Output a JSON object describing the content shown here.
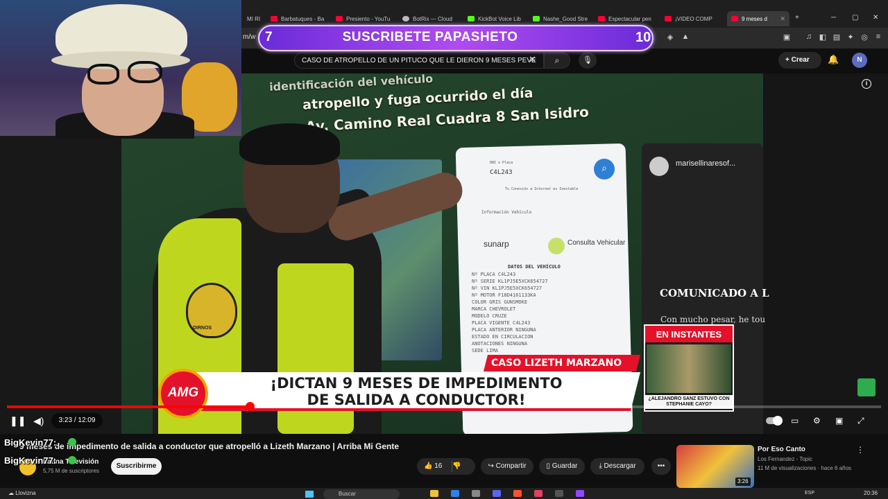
{
  "browser": {
    "tabs": [
      {
        "label": "MI RI",
        "active": false
      },
      {
        "label": "Barbatuques - Ba",
        "active": false
      },
      {
        "label": "Presiento - YouTu",
        "active": false
      },
      {
        "label": "BotRix — Cloud",
        "active": false
      },
      {
        "label": "KickBot Voice Lib",
        "active": false
      },
      {
        "label": "Nashe_Good Stre",
        "active": false
      },
      {
        "label": "Espectacular pen",
        "active": false
      },
      {
        "label": "¡VIDEO COMP",
        "active": false
      },
      {
        "label": "9 meses d",
        "active": true
      }
    ],
    "new_tab": "+",
    "address_fragment": "m/w"
  },
  "overlay": {
    "sub_left": "7",
    "sub_text": "SUSCRIBETE PAPASHETO",
    "sub_right": "10"
  },
  "youtube": {
    "search_value": "CASO DE ATROPELLO DE UN PITUCO QUE LE DIERON 9 MESES PEVE",
    "create_label": "Crear",
    "avatar_letter": "N"
  },
  "video": {
    "wall_line1": "identificación del vehículo",
    "wall_line2": "atropello y fuga ocurrido el día",
    "wall_line3": "Av. Camino Real Cuadra 8 San Isidro",
    "phone1": {
      "placa_label": "DNI o Placa",
      "placa_value": "C4L243",
      "conn_note": "Tu Conexión a Internet es Inestable",
      "info_label": "Información Vehículo",
      "sunarp": "sunarp",
      "consulta": "Consulta Vehicular",
      "datos_title": "DATOS DEL VEHÍCULO",
      "rows": [
        "Nº PLACA      C4L243",
        "Nº SERIE      KL1PJ5E5XCK654727",
        "Nº VIN        KL1PJ5E5XCK654727",
        "Nº MOTOR      F18D4161133KA",
        "COLOR         GRIS GUNSMOKE",
        "MARCA         CHEVROLET",
        "MODELO        CRUZE",
        "PLACA VIGENTE C4L243",
        "PLACA ANTERIOR NINGUNA",
        "ESTADO        EN CIRCULACION",
        "ANOTACIONES   NINGUNA",
        "SEDE          LIMA"
      ]
    },
    "phone2": {
      "handle": "marisellinaresof...",
      "title": "COMUNICADO A L",
      "body": "Con mucho pesar, he tou"
    },
    "badge_text": "DIRNOS",
    "caso": "CASO LIZETH MARZANO",
    "headline1": "¡DICTAN 9 MESES DE IMPEDIMENTO",
    "headline2": "DE SALIDA A CONDUCTOR!",
    "logo": "AMG",
    "instantes": "EN INSTANTES",
    "instantes_caption": "¿ALEJANDRO SANZ ESTUVO CON STEPHANIE CAYO?",
    "progress_fraction": 0.278,
    "time_current": "3:23",
    "time_total": "12:09",
    "time_display": "3:23 / 12:09"
  },
  "webcam": {
    "chat": [
      {
        "name": "BigKevin77",
        "suffix": ":"
      },
      {
        "name": "BigKevin77",
        "suffix": ":"
      }
    ]
  },
  "below": {
    "title": "9 meses de impedimento de salida a conductor que atropelló a Lizeth Marzano | Arriba Mi Gente",
    "title_visible": "9 meses de impedimento de salida a conductor que atropelló a Lizeth Marzano | Arriba Mi Gente",
    "channel": "Latina Televisión",
    "subs": "5,75 M de suscriptores",
    "subscribe": "Suscribirme",
    "likes": "16",
    "share": "Compartir",
    "save": "Guardar",
    "download": "Descargar",
    "more": "•••"
  },
  "recommendation": {
    "title": "Por Eso Canto",
    "artist": "Los Fernandez - Topic",
    "meta": "11 M de visualizaciones · hace 6 años",
    "duration": "3:26"
  },
  "taskbar": {
    "weather": "Llovizna",
    "search": "Buscar",
    "lang": "ESP",
    "clock": "20:36"
  }
}
